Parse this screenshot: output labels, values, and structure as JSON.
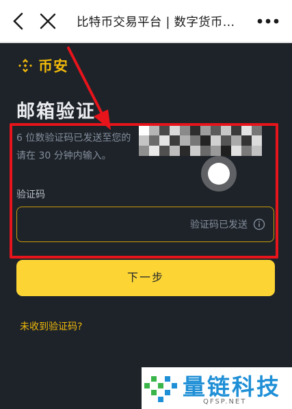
{
  "browser": {
    "title": "比特币交易平台 | 数字货币...",
    "back_icon": "chevron-left-icon",
    "close_icon": "close-icon",
    "more_icon": "more-dots-icon"
  },
  "logo": {
    "brand": "币安",
    "icon": "binance-logo-icon",
    "color": "#f0b90b"
  },
  "heading": "邮箱验证",
  "message": {
    "line1": "6 位数验证码已发送至您的",
    "line2": "请在 30 分钟内输入。"
  },
  "field": {
    "label": "验证码",
    "placeholder": "验证码已发送",
    "info_icon": "info-icon"
  },
  "next_button": {
    "label": "下一步",
    "color": "#fcd535"
  },
  "resend_link": "未收到验证码?",
  "watermark": {
    "text": "量链科技",
    "sub": "QFSP.NET"
  },
  "colors": {
    "background": "#1e2329",
    "accent": "#f0b90b",
    "annotation": "#e8141b"
  }
}
